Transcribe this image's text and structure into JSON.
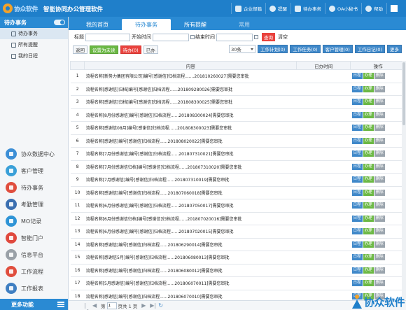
{
  "app": {
    "logo_text": "协众软件",
    "title": "智能协同办公管理软件",
    "top_actions": [
      "企业邮箱",
      "提醒",
      "待办事务",
      "OA小秘书",
      "帮助"
    ]
  },
  "sidebar": {
    "header": "待办事务",
    "sub_items": [
      "待办事务",
      "所有提醒",
      "我的日程"
    ],
    "menu": [
      {
        "label": "协众数据中心",
        "color": "#3d8fd6"
      },
      {
        "label": "客户管理",
        "color": "#3aa0d8"
      },
      {
        "label": "待办事务",
        "color": "#e04e3e"
      },
      {
        "label": "考勤管理",
        "color": "#3b6fb0"
      },
      {
        "label": "MO记录",
        "color": "#2f94d6"
      },
      {
        "label": "智能门户",
        "color": "#e0493e"
      },
      {
        "label": "信息平台",
        "color": "#9aa1a8"
      },
      {
        "label": "工作流程",
        "color": "#e04e3e"
      },
      {
        "label": "工作报表",
        "color": "#3f7fc2"
      }
    ],
    "footer": "更多功能"
  },
  "tabs": [
    {
      "label": "我的首页",
      "state": "normal"
    },
    {
      "label": "待办事务",
      "state": "active"
    },
    {
      "label": "所有提醒",
      "state": "normal"
    },
    {
      "label": "常用",
      "state": "dim"
    }
  ],
  "filter": {
    "title_label": "标题",
    "start_label": "开始时间",
    "end_label": "结束时间",
    "search_btn": "查询",
    "clear_btn": "清空"
  },
  "toolbar": {
    "back": "返回",
    "set_done": "设置为未读",
    "pending": "待办(0)",
    "done": "已办",
    "page_size": "30条",
    "right_buttons": [
      "工作计划(0)",
      "工作任务(0)",
      "客户管理(0)",
      "工作日记(0)",
      "更多"
    ]
  },
  "table": {
    "headers": [
      "",
      "内容",
      "已办时间",
      "操作"
    ],
    "op_labels": [
      "日程",
      "办理",
      "删除"
    ],
    "rows": [
      {
        "n": "1",
        "text": "流程名称[新势力集团有限公司]编号[感谢信]归档流程.......201810260027]需要您审批"
      },
      {
        "n": "2",
        "text": "流程名称[感谢信]归档]编号[感谢信]归档流程......201809280026]需要您审批"
      },
      {
        "n": "3",
        "text": "流程名称[感谢信]归档]编号[感谢信]归档流程......201808300025]需要您审批"
      },
      {
        "n": "4",
        "text": "流程名称[8月份感谢信]编号[感谢信]归档流程......201808300024]需要您审批"
      },
      {
        "n": "5",
        "text": "流程名称[感谢信08月]编号[感谢信]归档流程......201808300023]需要您审批"
      },
      {
        "n": "6",
        "text": "流程名称[感谢信]编号[感谢信]归档流程......201808020022]需要您审批"
      },
      {
        "n": "7",
        "text": "流程名称[7月份感谢信]编号[感谢信]归档流程......201807310021]需要您审批"
      },
      {
        "n": "8",
        "text": "流程名称[7月份感谢信归档]编号[感谢信]归档流程......201807310020]需要您审批"
      },
      {
        "n": "9",
        "text": "流程名称[7月感谢信]编号[感谢信]归档流程......201807310019]需要您审批"
      },
      {
        "n": "10",
        "text": "流程名称[感谢信]编号[感谢信]归档流程......201807060018]需要您审批"
      },
      {
        "n": "11",
        "text": "流程名称[6月份感谢信]编号[感谢信]归档流程......201807050017]需要您审批"
      },
      {
        "n": "12",
        "text": "流程名称[6月份感谢信归档]编号[感谢信]归档流程......201807020016]需要您审批"
      },
      {
        "n": "13",
        "text": "流程名称[6月份感谢信]编号[感谢信]归档流程......201807020015]需要您审批"
      },
      {
        "n": "14",
        "text": "流程名称[感谢信]编号[感谢信]归档流程......201806290014]需要您审批"
      },
      {
        "n": "15",
        "text": "流程名称[感谢信5月]编号[感谢信]归档流程......201806080013]需要您审批"
      },
      {
        "n": "16",
        "text": "流程名称[感谢信]编号[感谢信]归档流程......201806080012]需要您审批"
      },
      {
        "n": "17",
        "text": "流程名称[5月感谢信]编号[感谢信]归档流程......201806070011]需要您审批"
      },
      {
        "n": "18",
        "text": "流程名称[感谢信]编号[感谢信]归档流程......201806070010]需要您审批"
      }
    ]
  },
  "pager": {
    "page_label_pre": "第",
    "page_value": "1",
    "page_label_post": "页共 1 页"
  },
  "watermark": "协众软件"
}
